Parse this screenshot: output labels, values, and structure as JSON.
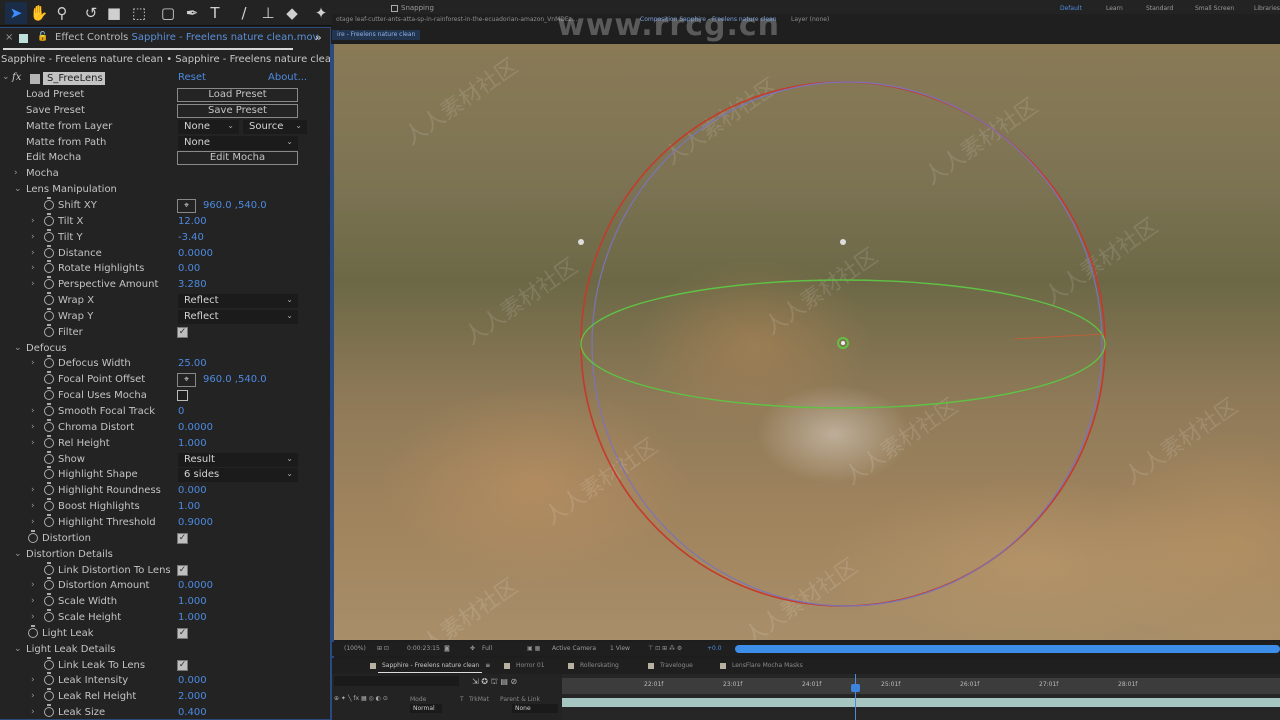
{
  "toolbar": {
    "tools": [
      {
        "name": "selection-tool",
        "glyph": "➤",
        "active": true
      },
      {
        "name": "hand-tool",
        "glyph": "✋"
      },
      {
        "name": "zoom-tool",
        "glyph": "⚲"
      },
      {
        "name": "rotate-tool",
        "glyph": "↺"
      },
      {
        "name": "camera-tool",
        "glyph": "■"
      },
      {
        "name": "pan-behind-tool",
        "glyph": "⬚"
      },
      {
        "name": "rectangle-tool",
        "glyph": "▢"
      },
      {
        "name": "pen-tool",
        "glyph": "✒"
      },
      {
        "name": "type-tool",
        "glyph": "T"
      },
      {
        "name": "brush-tool",
        "glyph": "/"
      },
      {
        "name": "clone-stamp-tool",
        "glyph": "⊥"
      },
      {
        "name": "eraser-tool",
        "glyph": "◆"
      },
      {
        "name": "puppet-tool",
        "glyph": "✦"
      }
    ],
    "snapping_label": "Snapping",
    "workspaces": [
      {
        "label": "Default",
        "active": true
      },
      {
        "label": "Learn"
      },
      {
        "label": "Standard"
      },
      {
        "label": "Small Screen"
      },
      {
        "label": "Libraries"
      }
    ]
  },
  "effect_controls": {
    "tab_prefix": "Effect Controls",
    "tab_file": "Sapphire - Freelens nature clean.mov",
    "more_label": "»",
    "subtitle": "Sapphire - Freelens nature clean • Sapphire - Freelens nature clean.mov",
    "effect": {
      "name": "S_FreeLens",
      "reset_label": "Reset",
      "about_label": "About..."
    },
    "rows": [
      {
        "label": "Load Preset",
        "indent": 1,
        "type": "button",
        "value": "Load Preset"
      },
      {
        "label": "Save Preset",
        "indent": 1,
        "type": "button",
        "value": "Save Preset"
      },
      {
        "label": "Matte from Layer",
        "indent": 1,
        "type": "dual-dropdown",
        "value": "None",
        "value2": "Source"
      },
      {
        "label": "Matte from Path",
        "indent": 1,
        "type": "dropdown",
        "value": "None"
      },
      {
        "label": "Edit Mocha",
        "indent": 1,
        "type": "button",
        "value": "Edit Mocha"
      },
      {
        "label": "Mocha",
        "indent": 1,
        "type": "group",
        "expanded": false
      },
      {
        "label": "Lens Manipulation",
        "indent": 1,
        "type": "group",
        "expanded": true
      },
      {
        "label": "Shift XY",
        "indent": 2,
        "type": "point",
        "value": "960.0 ,540.0",
        "stopwatch": true
      },
      {
        "label": "Tilt X",
        "indent": 2,
        "type": "number",
        "value": "12.00",
        "stopwatch": true,
        "twirl": true
      },
      {
        "label": "Tilt Y",
        "indent": 2,
        "type": "number",
        "value": "-3.40",
        "stopwatch": true,
        "twirl": true
      },
      {
        "label": "Distance",
        "indent": 2,
        "type": "number",
        "value": "0.0000",
        "stopwatch": true,
        "twirl": true
      },
      {
        "label": "Rotate Highlights",
        "indent": 2,
        "type": "number",
        "value": "0.00",
        "stopwatch": true,
        "twirl": true
      },
      {
        "label": "Perspective Amount",
        "indent": 2,
        "type": "number",
        "value": "3.280",
        "stopwatch": true,
        "twirl": true
      },
      {
        "label": "Wrap X",
        "indent": 2,
        "type": "dropdown",
        "value": "Reflect",
        "stopwatch": true
      },
      {
        "label": "Wrap Y",
        "indent": 2,
        "type": "dropdown",
        "value": "Reflect",
        "stopwatch": true
      },
      {
        "label": "Filter",
        "indent": 2,
        "type": "checkbox",
        "checked": true,
        "stopwatch": true
      },
      {
        "label": "Defocus",
        "indent": 1,
        "type": "group",
        "expanded": true
      },
      {
        "label": "Defocus Width",
        "indent": 2,
        "type": "number",
        "value": "25.00",
        "stopwatch": true,
        "twirl": true
      },
      {
        "label": "Focal Point Offset",
        "indent": 2,
        "type": "point",
        "value": "960.0 ,540.0",
        "stopwatch": true
      },
      {
        "label": "Focal Uses Mocha",
        "indent": 2,
        "type": "checkbox",
        "checked": false,
        "stopwatch": true
      },
      {
        "label": "Smooth Focal Track",
        "indent": 2,
        "type": "number",
        "value": "0",
        "stopwatch": true,
        "twirl": true
      },
      {
        "label": "Chroma Distort",
        "indent": 2,
        "type": "number",
        "value": "0.0000",
        "stopwatch": true,
        "twirl": true
      },
      {
        "label": "Rel Height",
        "indent": 2,
        "type": "number",
        "value": "1.000",
        "stopwatch": true,
        "twirl": true
      },
      {
        "label": "Show",
        "indent": 2,
        "type": "dropdown",
        "value": "Result",
        "stopwatch": true
      },
      {
        "label": "Highlight Shape",
        "indent": 2,
        "type": "dropdown",
        "value": "6 sides",
        "stopwatch": true
      },
      {
        "label": "Highlight Roundness",
        "indent": 2,
        "type": "number",
        "value": "0.000",
        "stopwatch": true,
        "twirl": true
      },
      {
        "label": "Boost Highlights",
        "indent": 2,
        "type": "number",
        "value": "1.00",
        "stopwatch": true,
        "twirl": true
      },
      {
        "label": "Highlight Threshold",
        "indent": 2,
        "type": "number",
        "value": "0.9000",
        "stopwatch": true,
        "twirl": true
      },
      {
        "label": "Distortion",
        "indent": 1,
        "type": "checkbox",
        "checked": true,
        "stopwatch": true
      },
      {
        "label": "Distortion Details",
        "indent": 1,
        "type": "group",
        "expanded": true
      },
      {
        "label": "Link Distortion To Lens",
        "indent": 2,
        "type": "checkbox",
        "checked": true,
        "stopwatch": true
      },
      {
        "label": "Distortion Amount",
        "indent": 2,
        "type": "number",
        "value": "0.0000",
        "stopwatch": true,
        "twirl": true
      },
      {
        "label": "Scale Width",
        "indent": 2,
        "type": "number",
        "value": "1.000",
        "stopwatch": true,
        "twirl": true
      },
      {
        "label": "Scale Height",
        "indent": 2,
        "type": "number",
        "value": "1.000",
        "stopwatch": true,
        "twirl": true
      },
      {
        "label": "Light Leak",
        "indent": 1,
        "type": "checkbox",
        "checked": true,
        "stopwatch": true
      },
      {
        "label": "Light Leak Details",
        "indent": 1,
        "type": "group",
        "expanded": true
      },
      {
        "label": "Link Leak To Lens",
        "indent": 2,
        "type": "checkbox",
        "checked": true,
        "stopwatch": true
      },
      {
        "label": "Leak Intensity",
        "indent": 2,
        "type": "number",
        "value": "0.000",
        "stopwatch": true,
        "twirl": true
      },
      {
        "label": "Leak Rel Height",
        "indent": 2,
        "type": "number",
        "value": "2.000",
        "stopwatch": true,
        "twirl": true
      },
      {
        "label": "Leak Size",
        "indent": 2,
        "type": "number",
        "value": "0.400",
        "stopwatch": true,
        "twirl": true
      }
    ]
  },
  "composition": {
    "footage_tab": "otage  leaf-cutter-ants-atta-sp-in-rainforest-in-the-ecuadorian-amazon_VnMDEz...",
    "comp_tab": "Composition  Sapphire - Freelens nature clean",
    "layer_tab": "Layer (none)",
    "breadcrumb": "ire - Freelens nature clean",
    "watermark_url": "www.rrcg.cn",
    "watermark_cn": "人人素材社区"
  },
  "viewer_bar": {
    "zoom": "(100%)",
    "timecode": "0:00:23:15",
    "resolution": "Full",
    "camera": "Active Camera",
    "views": "1 View",
    "exposure": "+0.0"
  },
  "timeline": {
    "tabs": [
      {
        "label": "Sapphire - Freelens nature clean",
        "active": true
      },
      {
        "label": "Horror 01"
      },
      {
        "label": "Rollerskating"
      },
      {
        "label": "Travelogue"
      },
      {
        "label": "LensFlare Mocha Masks"
      }
    ],
    "columns": {
      "mode": "Mode",
      "t": "T",
      "trkmat": "TrkMat",
      "parent": "Parent & Link"
    },
    "layer_mode": "Normal",
    "layer_parent": "None",
    "ruler_ticks": [
      "22:01f",
      "23:01f",
      "24:01f",
      "25:01f",
      "26:01f",
      "27:01f",
      "28:01f"
    ],
    "playhead_time": "23:15f"
  }
}
